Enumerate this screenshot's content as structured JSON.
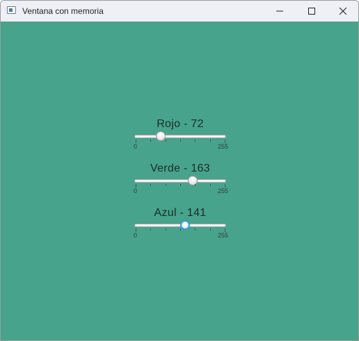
{
  "window": {
    "title": "Ventana con memoria",
    "background_color": "#48a38c"
  },
  "controls": {
    "minimize_icon": "minimize-icon",
    "maximize_icon": "maximize-icon",
    "close_icon": "close-icon"
  },
  "sliders": [
    {
      "label": "Rojo - 72",
      "value": 72,
      "min": 0,
      "max": 255,
      "min_label": "0",
      "max_label": "255",
      "focused": false
    },
    {
      "label": "Verde - 163",
      "value": 163,
      "min": 0,
      "max": 255,
      "min_label": "0",
      "max_label": "255",
      "focused": false
    },
    {
      "label": "Azul - 141",
      "value": 141,
      "min": 0,
      "max": 255,
      "min_label": "0",
      "max_label": "255",
      "focused": true
    }
  ]
}
